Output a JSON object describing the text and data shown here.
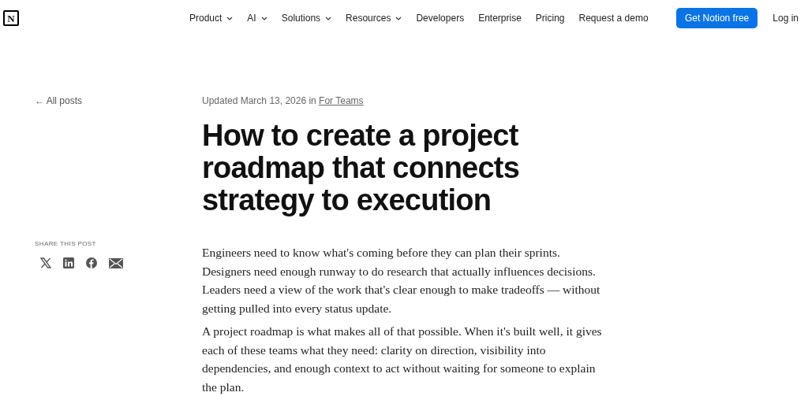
{
  "header": {
    "logo": "N",
    "nav": [
      {
        "label": "Product",
        "dropdown": true
      },
      {
        "label": "AI",
        "dropdown": true
      },
      {
        "label": "Solutions",
        "dropdown": true
      },
      {
        "label": "Resources",
        "dropdown": true
      },
      {
        "label": "Developers",
        "dropdown": false
      },
      {
        "label": "Enterprise",
        "dropdown": false
      },
      {
        "label": "Pricing",
        "dropdown": false
      },
      {
        "label": "Request a demo",
        "dropdown": false
      }
    ],
    "cta": "Get Notion free",
    "login": "Log in"
  },
  "back_link": "← All posts",
  "share": {
    "label": "SHARE THIS POST",
    "icons": [
      {
        "kind": "x"
      },
      {
        "kind": "linkedin"
      },
      {
        "kind": "facebook"
      },
      {
        "kind": "email"
      }
    ]
  },
  "meta": {
    "text": "Updated March 13, 2026 in",
    "category": "For Teams"
  },
  "title": "How to create a project roadmap that connects strategy to execution",
  "paragraphs": [
    "Engineers need to know what's coming before they can plan their sprints. Designers need enough runway to do research that actually influences decisions. Leaders need a view of the work that's clear enough to make tradeoffs — without getting pulled into every status update.",
    "A project roadmap is what makes all of that possible. When it's built well, it gives each of these teams what they need: clarity on direction, visibility into dependencies, and enough context to act without waiting for someone to explain the plan."
  ]
}
